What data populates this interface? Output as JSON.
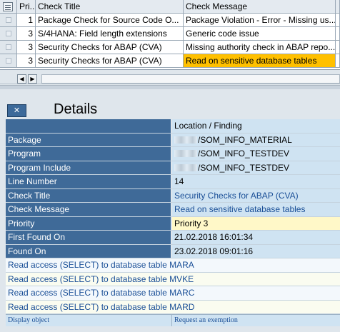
{
  "grid": {
    "columns": [
      "Pri...",
      "Check Title",
      "Check Message"
    ],
    "rows": [
      {
        "priority": "1",
        "title": "Package Check for Source Code O...",
        "message": "Package Violation - Error - Missing us...",
        "highlight": false
      },
      {
        "priority": "3",
        "title": "S/4HANA: Field length extensions",
        "message": "Generic code issue",
        "highlight": false
      },
      {
        "priority": "3",
        "title": "Security Checks for ABAP (CVA)",
        "message": "Missing authority check in ABAP repo...",
        "highlight": false
      },
      {
        "priority": "3",
        "title": "Security Checks for ABAP (CVA)",
        "message": "Read on sensitive database tables",
        "highlight": true
      }
    ]
  },
  "scroll": {
    "left": "◀",
    "right": "▶"
  },
  "details": {
    "close": "✕",
    "title": "Details",
    "header_value": "Location / Finding",
    "fields": [
      {
        "label": "Package",
        "value": "/SOM_INFO_MATERIAL",
        "redacted": true,
        "style": "plain"
      },
      {
        "label": "Program",
        "value": "/SOM_INFO_TESTDEV",
        "redacted": true,
        "style": "plain"
      },
      {
        "label": "Program Include",
        "value": "/SOM_INFO_TESTDEV",
        "redacted": true,
        "style": "plain"
      },
      {
        "label": "Line Number",
        "value": "14",
        "redacted": false,
        "style": "plain"
      },
      {
        "label": "Check Title",
        "value": "Security Checks for ABAP (CVA)",
        "redacted": false,
        "style": "link"
      },
      {
        "label": "Check Message",
        "value": "Read on sensitive database tables",
        "redacted": false,
        "style": "link"
      },
      {
        "label": "Priority",
        "value": "Priority 3",
        "redacted": false,
        "style": "yellow"
      },
      {
        "label": "First Found On",
        "value": "21.02.2018 16:01:34",
        "redacted": false,
        "style": "plain"
      },
      {
        "label": "Found On",
        "value": "23.02.2018 09:01:16",
        "redacted": false,
        "style": "plain"
      }
    ],
    "findings": [
      "Read access (SELECT) to database table MARA",
      "Read access (SELECT) to database table MVKE",
      "Read access (SELECT) to database table MARC",
      "Read access (SELECT) to database table MARD"
    ],
    "footer": {
      "display_object": "Display object",
      "request_exemption": "Request an exemption"
    }
  }
}
